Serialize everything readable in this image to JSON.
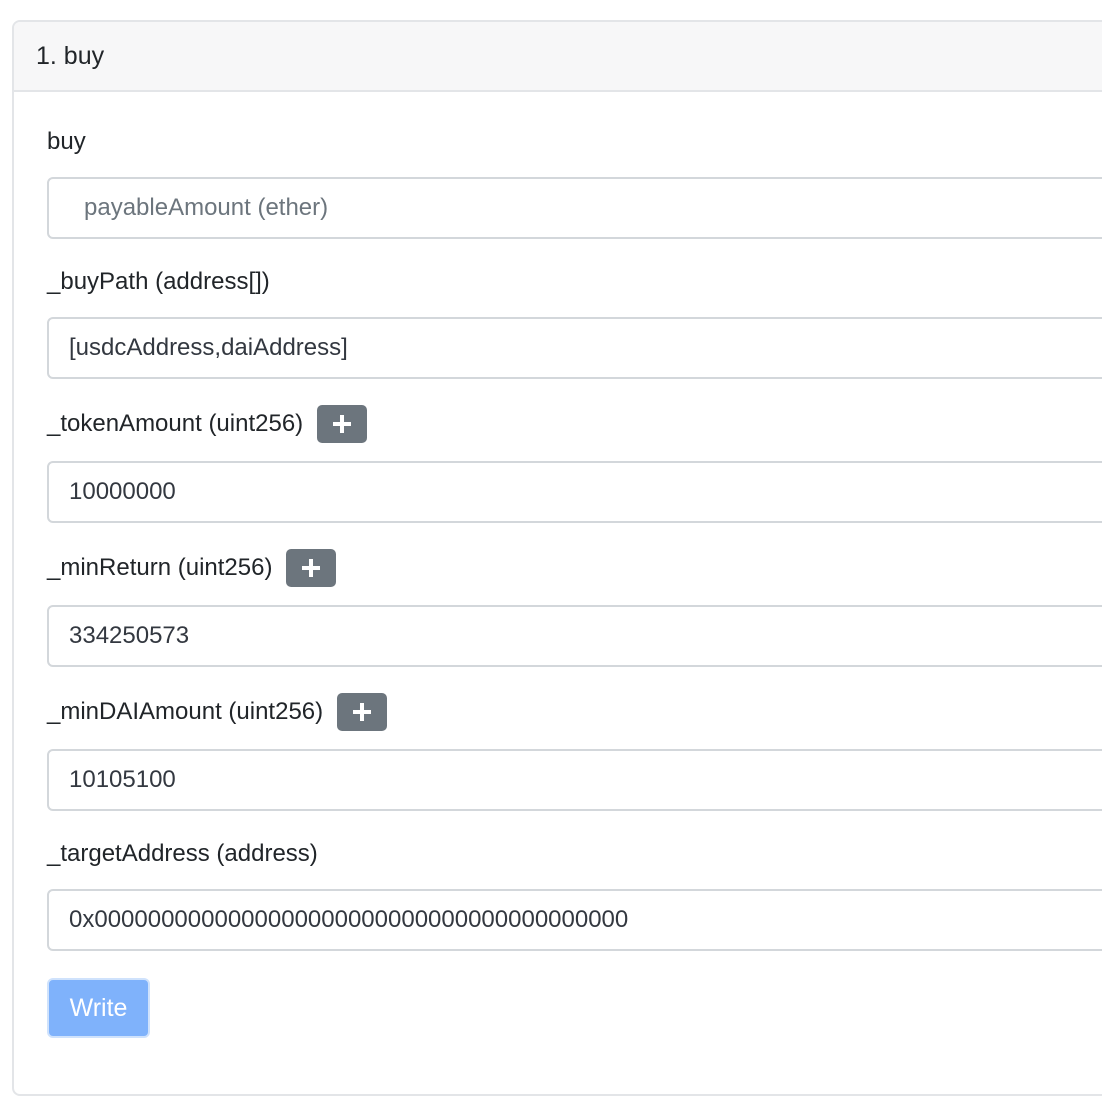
{
  "function_card": {
    "title": "1. buy",
    "payable": {
      "label": "buy",
      "value": "",
      "placeholder": "payableAmount (ether)"
    },
    "params": [
      {
        "label": "_buyPath (address[])",
        "value": "[usdcAddress,daiAddress]",
        "has_plus": false
      },
      {
        "label": "_tokenAmount (uint256)",
        "value": "10000000",
        "has_plus": true
      },
      {
        "label": "_minReturn (uint256)",
        "value": "334250573",
        "has_plus": true
      },
      {
        "label": "_minDAIAmount (uint256)",
        "value": "10105100",
        "has_plus": true
      },
      {
        "label": "_targetAddress (address)",
        "value": "0x0000000000000000000000000000000000000000",
        "has_plus": false
      }
    ],
    "write_button_label": "Write"
  },
  "icons": {
    "plus": "plus-icon"
  },
  "colors": {
    "header_bg": "#f7f7f8",
    "plus_button_bg": "#6c757d",
    "write_button_bg": "#7fb2fb",
    "border": "#d3d7db"
  }
}
